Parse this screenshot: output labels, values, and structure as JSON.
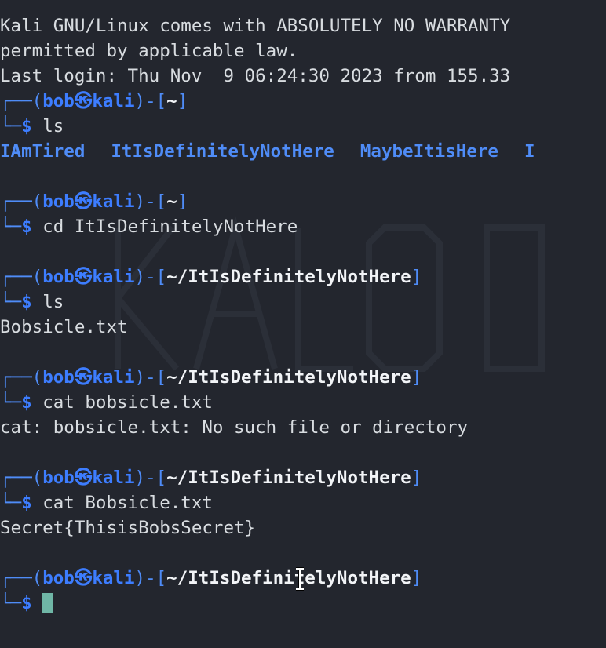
{
  "banner": [
    "Kali GNU/Linux comes with ABSOLUTELY NO WARRANTY",
    "permitted by applicable law.",
    "Last login: Thu Nov  9 06:24:30 2023 from 155.33"
  ],
  "prompt": {
    "user": "bob",
    "host": "kali",
    "at_symbol": "㉿",
    "corner_top": "┌──(",
    "mid": ")-[",
    "end": "]",
    "corner_bottom": "└─",
    "dollar": "$"
  },
  "blocks": [
    {
      "path": "~",
      "command": "ls",
      "output_dirs": [
        "IAmTired",
        "ItIsDefinitelyNotHere",
        "MaybeItisHere",
        "I"
      ]
    },
    {
      "path": "~",
      "command": "cd ItIsDefinitelyNotHere",
      "output": ""
    },
    {
      "path": "~/ItIsDefinitelyNotHere",
      "command": "ls",
      "output": "Bobsicle.txt"
    },
    {
      "path": "~/ItIsDefinitelyNotHere",
      "command": "cat bobsicle.txt",
      "output": "cat: bobsicle.txt: No such file or directory"
    },
    {
      "path": "~/ItIsDefinitelyNotHere",
      "command": "cat Bobsicle.txt",
      "output": "Secret{ThisisBobsSecret}"
    },
    {
      "path": "~/ItIsDefinitelyNotHere",
      "command": "",
      "output": ""
    }
  ],
  "colors": {
    "background": "#23262e",
    "prompt_blue": "#3d7dff",
    "text": "#d8dce0",
    "cursor": "#6fb6a6"
  }
}
